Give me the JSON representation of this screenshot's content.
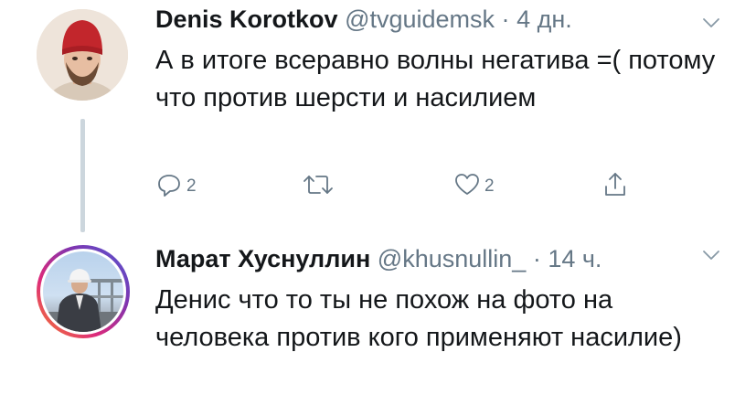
{
  "tweets": [
    {
      "author": "Denis Korotkov",
      "handle": "@tvguidemsk",
      "separator": "·",
      "time": "4 дн.",
      "text": "А в итоге всеравно волны негатива =( потому что против шерсти и насилием",
      "reply_count": "2",
      "like_count": "2"
    },
    {
      "author": "Марат Хуснуллин",
      "handle": "@khusnullin_",
      "separator": "·",
      "time": "14 ч.",
      "text": "Денис что то ты не похож на фото на человека против кого применяют насилие)"
    }
  ],
  "icons": {
    "reply": "reply-icon",
    "retweet": "retweet-icon",
    "like": "heart-icon",
    "share": "share-icon",
    "menu": "chevron-down-icon"
  },
  "colors": {
    "text": "#14171a",
    "secondary": "#657786",
    "thread_line": "#ccd6dd"
  }
}
